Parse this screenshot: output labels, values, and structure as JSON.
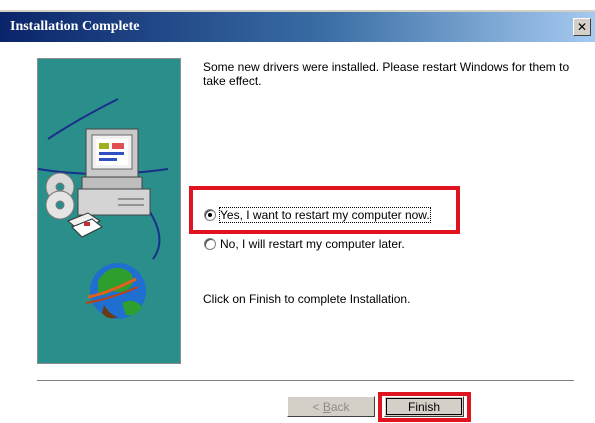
{
  "window": {
    "title": "Installation Complete",
    "close_icon": "close-icon"
  },
  "content": {
    "message": "Some new drivers were installed. Please restart Windows for them to take effect.",
    "options": [
      {
        "label": "Yes, I want to restart my computer now.",
        "checked": true
      },
      {
        "label": "No, I will restart my computer later.",
        "checked": false
      }
    ],
    "finish_message": "Click on Finish to complete Installation."
  },
  "buttons": {
    "back_prefix": "< ",
    "back_accel": "B",
    "back_rest": "ack",
    "finish": "Finish"
  },
  "colors": {
    "titlebar_start": "#0a246a",
    "titlebar_end": "#a6caf0",
    "panel_teal": "#2a8f8b",
    "highlight_red": "#e0141e"
  }
}
